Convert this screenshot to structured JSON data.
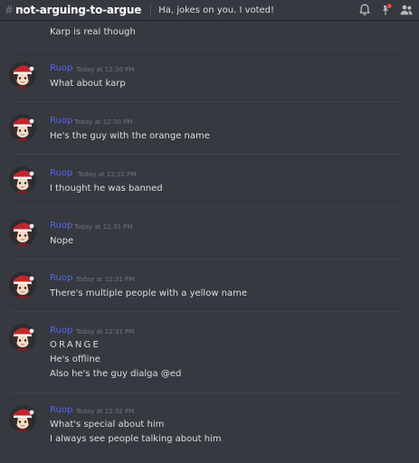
{
  "header": {
    "hash": "#",
    "channel_name": "not-arguing-to-argue",
    "topic": "Ha, jokes on you. I voted!"
  },
  "continuation_text": "Karp is real though",
  "messages": [
    {
      "username": "Ruop",
      "timestamp": "Today at 12:30 PM",
      "lines": [
        "What about karp"
      ]
    },
    {
      "username": "Ruop",
      "timestamp": "Today at 12:30 PM",
      "lines": [
        "He's the guy with the orange name"
      ]
    },
    {
      "username": "Ruop",
      "timestamp": "Today at 12:31 PM",
      "lines": [
        "I thought he was banned"
      ]
    },
    {
      "username": "Ruop",
      "timestamp": "Today at 12:31 PM",
      "lines": [
        "Nope"
      ]
    },
    {
      "username": "Ruop",
      "timestamp": "Today at 12:31 PM",
      "lines": [
        "There's multiple people with a yellow name"
      ]
    },
    {
      "username": "Ruop",
      "timestamp": "Today at 12:31 PM",
      "lines": [
        "ORANGE",
        "He's offline",
        "Also he's the guy dialga @ed"
      ]
    },
    {
      "username": "Ruop",
      "timestamp": "Today at 12:32 PM",
      "lines": [
        "What's special about him",
        "I always see people talking about him"
      ]
    }
  ],
  "colors": {
    "background": "#36393f",
    "username": "#5865f2",
    "timestamp": "#72767d",
    "text": "#dcddde",
    "notification_badge": "#ed4245"
  },
  "icons": [
    "bell-icon",
    "pinned-icon",
    "members-icon"
  ]
}
